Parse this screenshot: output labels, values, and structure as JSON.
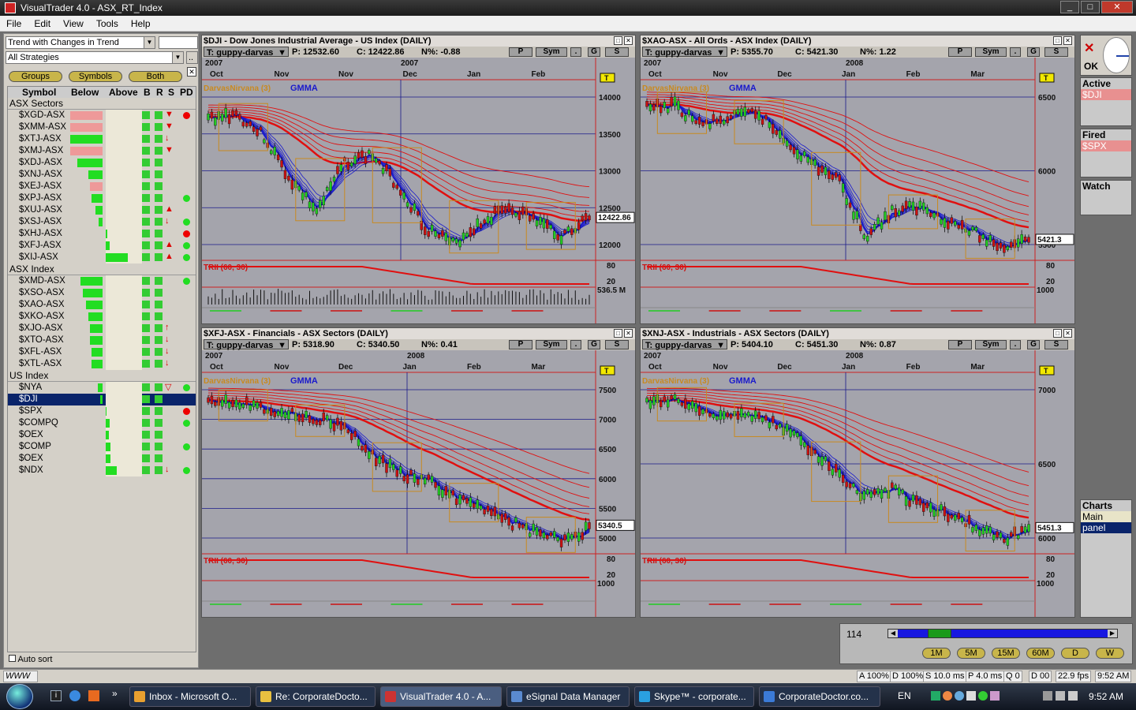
{
  "window": {
    "title": "VisualTrader 4.0 - ASX_RT_Index"
  },
  "menu": [
    "File",
    "Edit",
    "View",
    "Tools",
    "Help"
  ],
  "left": {
    "combo1": "Trend with Changes in Trend",
    "combo2": "All Strategies",
    "tabs": [
      "Groups",
      "Symbols",
      "Both"
    ],
    "headers": [
      "Symbol",
      "Below",
      "Above",
      "B",
      "R",
      "S",
      "PD"
    ],
    "groups": [
      {
        "name": "ASX Sectors",
        "rows": [
          {
            "sym": "$XGD-ASX",
            "below": 0.9,
            "col": "#ee9999",
            "above": 0,
            "s": "▼",
            "pd": "#e00"
          },
          {
            "sym": "$XMM-ASX",
            "below": 0.9,
            "col": "#ee9999",
            "above": 0,
            "s": "▼",
            "pd": ""
          },
          {
            "sym": "$XTJ-ASX",
            "below": 0.9,
            "col": "#22dd22",
            "above": 0,
            "s": "↓",
            "pd": ""
          },
          {
            "sym": "$XMJ-ASX",
            "below": 0.9,
            "col": "#ee9999",
            "above": 0,
            "s": "▼",
            "pd": ""
          },
          {
            "sym": "$XDJ-ASX",
            "below": 0.7,
            "col": "#22dd22",
            "above": 0,
            "s": "",
            "pd": ""
          },
          {
            "sym": "$XNJ-ASX",
            "below": 0.4,
            "col": "#22dd22",
            "above": 0,
            "s": "",
            "pd": ""
          },
          {
            "sym": "$XEJ-ASX",
            "below": 0.35,
            "col": "#ee9999",
            "above": 0,
            "s": "",
            "pd": ""
          },
          {
            "sym": "$XPJ-ASX",
            "below": 0.3,
            "col": "#22dd22",
            "above": 0,
            "s": "",
            "pd": "#2d2"
          },
          {
            "sym": "$XUJ-ASX",
            "below": 0.2,
            "col": "#22dd22",
            "above": 0,
            "s": "▲",
            "pd": ""
          },
          {
            "sym": "$XSJ-ASX",
            "below": 0.1,
            "col": "#22dd22",
            "above": 0,
            "s": "↓",
            "pd": "#2d2"
          },
          {
            "sym": "$XHJ-ASX",
            "below": 0,
            "col": "#22dd22",
            "above": 0.05,
            "s": "",
            "pd": "#e00"
          },
          {
            "sym": "$XFJ-ASX",
            "below": 0,
            "col": "#22dd22",
            "above": 0.1,
            "s": "▲",
            "pd": "#2d2"
          },
          {
            "sym": "$XIJ-ASX",
            "below": 0,
            "col": "#22dd22",
            "above": 0.6,
            "s": "▲",
            "pd": "#2d2"
          }
        ]
      },
      {
        "name": "ASX Index",
        "rows": [
          {
            "sym": "$XMD-ASX",
            "below": 0.6,
            "col": "#22dd22",
            "above": 0,
            "s": "",
            "pd": "#2d2"
          },
          {
            "sym": "$XSO-ASX",
            "below": 0.55,
            "col": "#22dd22",
            "above": 0,
            "s": "",
            "pd": ""
          },
          {
            "sym": "$XAO-ASX",
            "below": 0.45,
            "col": "#22dd22",
            "above": 0,
            "s": "",
            "pd": ""
          },
          {
            "sym": "$XKO-ASX",
            "below": 0.4,
            "col": "#22dd22",
            "above": 0,
            "s": "",
            "pd": ""
          },
          {
            "sym": "$XJO-ASX",
            "below": 0.35,
            "col": "#22dd22",
            "above": 0,
            "s": "↑",
            "pd": ""
          },
          {
            "sym": "$XTO-ASX",
            "below": 0.35,
            "col": "#22dd22",
            "above": 0,
            "s": "↓",
            "pd": ""
          },
          {
            "sym": "$XFL-ASX",
            "below": 0.3,
            "col": "#22dd22",
            "above": 0,
            "s": "↓",
            "pd": ""
          },
          {
            "sym": "$XTL-ASX",
            "below": 0.3,
            "col": "#22dd22",
            "above": 0,
            "s": "↓",
            "pd": ""
          }
        ]
      },
      {
        "name": "US Index",
        "rows": [
          {
            "sym": "$NYA",
            "below": 0.12,
            "col": "#22dd22",
            "above": 0,
            "s": "▽",
            "pd": "#2d2"
          },
          {
            "sym": "$DJI",
            "below": 0.06,
            "col": "#22dd22",
            "above": 0,
            "s": "",
            "pd": "",
            "sel": true
          },
          {
            "sym": "$SPX",
            "below": 0,
            "col": "#22dd22",
            "above": 0.02,
            "s": "",
            "pd": "#e00"
          },
          {
            "sym": "$COMPQ",
            "below": 0,
            "col": "#22dd22",
            "above": 0.1,
            "s": "",
            "pd": "#2d2"
          },
          {
            "sym": "$OEX",
            "below": 0,
            "col": "#22dd22",
            "above": 0.08,
            "s": "",
            "pd": ""
          },
          {
            "sym": "$COMP",
            "below": 0,
            "col": "#22dd22",
            "above": 0.12,
            "s": "",
            "pd": "#2d2"
          },
          {
            "sym": "$OEX",
            "below": 0,
            "col": "#22dd22",
            "above": 0.12,
            "s": "",
            "pd": ""
          },
          {
            "sym": "$NDX",
            "below": 0,
            "col": "#22dd22",
            "above": 0.3,
            "s": "↓",
            "pd": "#2d2"
          }
        ]
      }
    ],
    "autosort": "Auto sort"
  },
  "panels": [
    {
      "title": "$DJI - Dow Jones Industrial Average - US Index (DAILY)",
      "tpl": "T: guppy-darvas",
      "p": "P: 12532.60",
      "c": "C: 12422.86",
      "n": "N%: -0.88",
      "years": [
        [
          "2007",
          4
        ],
        [
          "2007",
          252
        ]
      ],
      "months": [
        "Oct",
        "Nov",
        "Nov",
        "Dec",
        "Jan",
        "Feb"
      ],
      "yticks": [
        "14000",
        "13500",
        "13000",
        "12500",
        "12000"
      ],
      "last": "12422.86",
      "ind": "TRII (60, 30)",
      "ind2": [
        "80",
        "20"
      ],
      "vol": "536.5 M",
      "gmma": "GMMA",
      "darvas": "DarvasNirvana (3)"
    },
    {
      "title": "$XAO-ASX - All Ords - ASX Index (DAILY)",
      "tpl": "T: guppy-darvas",
      "p": "P: 5355.70",
      "c": "C: 5421.30",
      "n": "N%: 1.22",
      "years": [
        [
          "2007",
          4
        ],
        [
          "2008",
          260
        ]
      ],
      "months": [
        "Oct",
        "Nov",
        "Dec",
        "Jan",
        "Feb",
        "Mar"
      ],
      "yticks": [
        "6500",
        "6000",
        "5500"
      ],
      "last": "5421.3",
      "ind": "TRII (60, 30)",
      "ind2": [
        "80",
        "20"
      ],
      "vol": "1000",
      "gmma": "GMMA",
      "darvas": "DarvasNirvana (3)"
    },
    {
      "title": "$XFJ-ASX - Financials - ASX Sectors (DAILY)",
      "tpl": "T: guppy-darvas",
      "p": "P: 5318.90",
      "c": "C: 5340.50",
      "n": "N%: 0.41",
      "years": [
        [
          "2007",
          4
        ],
        [
          "2008",
          260
        ]
      ],
      "months": [
        "Oct",
        "Nov",
        "Dec",
        "Jan",
        "Feb",
        "Mar"
      ],
      "yticks": [
        "7500",
        "7000",
        "6500",
        "6000",
        "5500",
        "5000"
      ],
      "last": "5340.5",
      "ind": "TRII (60, 30)",
      "ind2": [
        "80",
        "20"
      ],
      "vol": "1000",
      "gmma": "GMMA",
      "darvas": "DarvasNirvana (3)"
    },
    {
      "title": "$XNJ-ASX - Industrials - ASX Sectors (DAILY)",
      "tpl": "T: guppy-darvas",
      "p": "P: 5404.10",
      "c": "C: 5451.30",
      "n": "N%: 0.87",
      "years": [
        [
          "2007",
          4
        ],
        [
          "2008",
          260
        ]
      ],
      "months": [
        "Oct",
        "Nov",
        "Dec",
        "Jan",
        "Feb",
        "Mar"
      ],
      "yticks": [
        "7000",
        "6500",
        "6000"
      ],
      "last": "5451.3",
      "ind": "TRII (60, 30)",
      "ind2": [
        "80",
        "20"
      ],
      "vol": "1000",
      "gmma": "GMMA",
      "darvas": "DarvasNirvana (3)"
    }
  ],
  "panel_buttons": {
    "p": "P",
    "sym": "Sym",
    "dot": ".",
    "g": "G",
    "s": "S",
    "marker": "T"
  },
  "right": {
    "ok": "OK",
    "active_label": "Active",
    "active_items": [
      "$DJI"
    ],
    "fired_label": "Fired",
    "fired_items": [
      "$SPX"
    ],
    "watch_label": "Watch",
    "charts_label": "Charts",
    "charts_items": [
      "Main",
      "panel"
    ]
  },
  "scroll": {
    "value": "114",
    "progress": 0.16,
    "timeframes": [
      "1M",
      "5M",
      "15M",
      "60M",
      "D",
      "W"
    ]
  },
  "status": {
    "input": "WWW",
    "cells": [
      "A 100%",
      "D 100%",
      "S 10.0 ms",
      "P 4.0 ms",
      "Q 0",
      "D 00",
      "22.9 fps",
      "9:52 AM"
    ]
  },
  "taskbar": {
    "tasks": [
      {
        "label": "Inbox - Microsoft O...",
        "col": "#e8a030"
      },
      {
        "label": "Re: CorporateDocto...",
        "col": "#e8c040"
      },
      {
        "label": "VisualTrader 4.0 - A...",
        "col": "#c33",
        "active": true
      },
      {
        "label": "eSignal Data Manager",
        "col": "#5a8ad0"
      },
      {
        "label": "Skype™ - corporate...",
        "col": "#2aa0e0"
      },
      {
        "label": "CorporateDoctor.co...",
        "col": "#3b7bd8"
      }
    ],
    "lang": "EN",
    "clock": "9:52 AM"
  },
  "colors": {
    "blue": "#1a1acc",
    "red": "#e01010",
    "grid": "#1a1a8a",
    "orange": "#c88a20"
  }
}
